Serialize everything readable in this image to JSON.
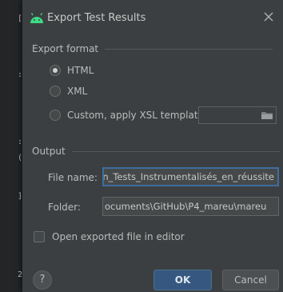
{
  "window": {
    "title": "Export Test Results"
  },
  "ide_edge_marks": [
    "[",
    ":",
    ":",
    "(",
    "]",
    "2"
  ],
  "export_format": {
    "section_label": "Export format",
    "options": [
      {
        "label": "HTML",
        "checked": true
      },
      {
        "label": "XML",
        "checked": false
      },
      {
        "label": "Custom, apply XSL template:",
        "checked": false
      }
    ],
    "xsl_template_value": ""
  },
  "output": {
    "section_label": "Output",
    "file_name_label": "File name:",
    "file_name_value": "ution_Tests_Instrumentalisés_en_réussite",
    "folder_label": "Folder:",
    "folder_value": "ocuments\\GitHub\\P4_mareu\\mareu",
    "open_in_editor_label": "Open exported file in editor",
    "open_in_editor_checked": false
  },
  "buttons": {
    "help": "?",
    "ok": "OK",
    "cancel": "Cancel"
  },
  "colors": {
    "dialog_bg": "#3c3f41",
    "accent_ok": "#365880",
    "focus_border": "#3d6e9e",
    "android_green": "#3ddc84"
  }
}
